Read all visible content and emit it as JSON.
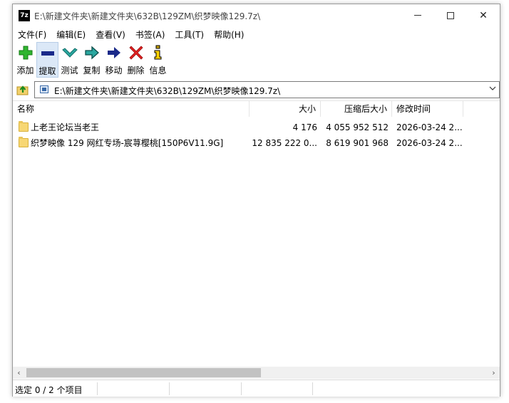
{
  "title_bar": {
    "icon_text": "7z",
    "title": "E:\\新建文件夹\\新建文件夹\\632B\\129ZM\\织梦映像129.7z\\"
  },
  "menu": [
    "文件(F)",
    "编辑(E)",
    "查看(V)",
    "书签(A)",
    "工具(T)",
    "帮助(H)"
  ],
  "toolbar": {
    "add": "添加",
    "extract": "提取",
    "test": "测试",
    "copy": "复制",
    "move": "移动",
    "delete": "删除",
    "info": "信息"
  },
  "address": {
    "path": "E:\\新建文件夹\\新建文件夹\\632B\\129ZM\\织梦映像129.7z\\"
  },
  "columns": {
    "name": "名称",
    "size": "大小",
    "packed": "压缩后大小",
    "modified": "修改时间"
  },
  "rows": [
    {
      "name": "上老王论坛当老王",
      "size": "4 176",
      "packed": "4 055 952 512",
      "modified": "2026-03-24 2..."
    },
    {
      "name": "织梦映像 129 网红专场-宸荨樱桃[150P6V11.9G]",
      "size": "12 835 222 0...",
      "packed": "8 619 901 968",
      "modified": "2026-03-24 2..."
    }
  ],
  "status": {
    "text": "选定 0 / 2 个项目"
  },
  "colors": {
    "folder": "#f7d774",
    "add_icon": "#2fb52f",
    "navy_icon": "#1a2a8a",
    "teal_icon": "#2aa7a0",
    "delete_icon": "#e02020",
    "info_icon": "#c9a400"
  }
}
